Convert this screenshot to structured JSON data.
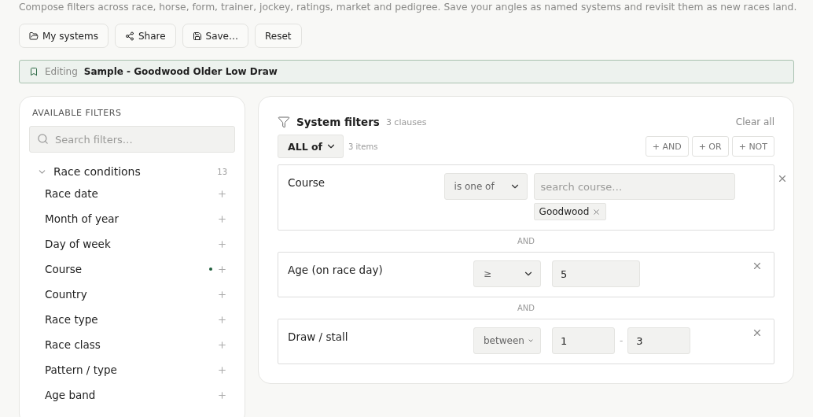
{
  "description": "Compose filters across race, horse, form, trainer, jockey, ratings, market and pedigree. Save your angles as named systems and revisit them as new races land.",
  "actions": [
    {
      "kind": "folder",
      "label": "My systems"
    },
    {
      "kind": "share",
      "label": "Share"
    },
    {
      "kind": "save",
      "label": "Save…"
    },
    {
      "kind": "plain",
      "label": "Reset"
    }
  ],
  "editing": {
    "label": "Editing",
    "name": "Sample - Goodwood Older Low Draw"
  },
  "available_filters": {
    "title": "AVAILABLE FILTERS",
    "search": {
      "placeholder": "Search filters…"
    },
    "groups": [
      {
        "label": "Race conditions",
        "count": "13",
        "expanded": true,
        "items": [
          {
            "label": "Race date",
            "in_use": false
          },
          {
            "label": "Month of year",
            "in_use": false
          },
          {
            "label": "Day of week",
            "in_use": false
          },
          {
            "label": "Course",
            "in_use": true
          },
          {
            "label": "Country",
            "in_use": false
          },
          {
            "label": "Race type",
            "in_use": false
          },
          {
            "label": "Race class",
            "in_use": false
          },
          {
            "label": "Pattern / type",
            "in_use": false
          },
          {
            "label": "Age band",
            "in_use": false
          }
        ]
      }
    ]
  },
  "system_filters": {
    "title": "System filters",
    "count": "3 clauses",
    "clear": "Clear all",
    "mode": "ALL of",
    "items_count": "3 items",
    "add_buttons": [
      "+ AND",
      "+ OR",
      "+ NOT"
    ],
    "clauses": [
      {
        "kind": "multi",
        "field": "Course",
        "operator": "is one of",
        "search": {
          "placeholder": "search course…"
        },
        "tags": [
          "Goodwood"
        ]
      },
      {
        "kind": "single",
        "field": "Age (on race day)",
        "operator": "≥",
        "value": "5"
      },
      {
        "kind": "range",
        "field": "Draw / stall",
        "operator": "between",
        "from": "1",
        "separator": "-",
        "to": "3"
      }
    ],
    "joiners": [
      "AND",
      "AND"
    ]
  }
}
